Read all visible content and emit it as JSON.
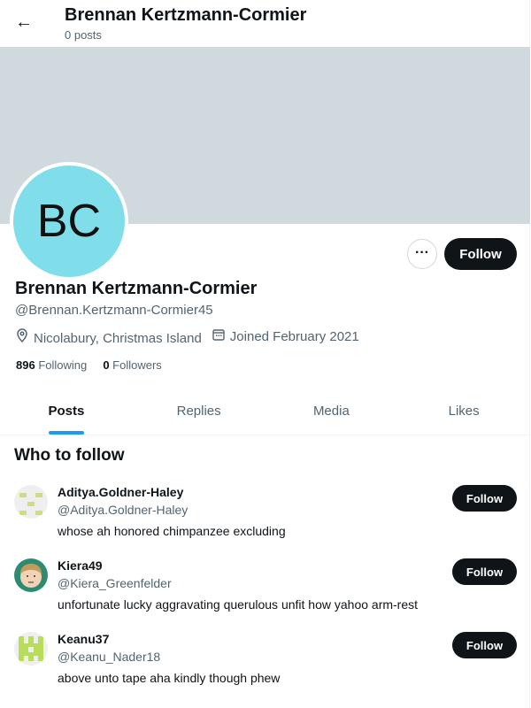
{
  "header": {
    "title": "Brennan Kertzmann-Cormier",
    "subtitle": "0 posts"
  },
  "profile": {
    "initials": "BC",
    "name": "Brennan Kertzmann-Cormier",
    "handle": "@Brennan.Kertzmann-Cormier45",
    "location": "Nicolabury, Christmas Island",
    "joined": "Joined February 2021",
    "following_count": "896",
    "following_label": "Following",
    "followers_count": "0",
    "followers_label": "Followers",
    "follow_label": "Follow",
    "more_label": "···",
    "avatar_color": "#80deea"
  },
  "tabs": [
    {
      "label": "Posts"
    },
    {
      "label": "Replies"
    },
    {
      "label": "Media"
    },
    {
      "label": "Likes"
    }
  ],
  "who_to_follow": {
    "title": "Who to follow",
    "items": [
      {
        "name": "Aditya.Goldner-Haley",
        "handle": "@Aditya.Goldner-Haley",
        "bio": "whose ah honored chimpanzee excluding",
        "follow": "Follow"
      },
      {
        "name": "Kiera49",
        "handle": "@Kiera_Greenfelder",
        "bio": "unfortunate lucky aggravating querulous unfit how yahoo arm-rest",
        "follow": "Follow"
      },
      {
        "name": "Keanu37",
        "handle": "@Keanu_Nader18",
        "bio": "above unto tape aha kindly though phew",
        "follow": "Follow"
      }
    ]
  }
}
